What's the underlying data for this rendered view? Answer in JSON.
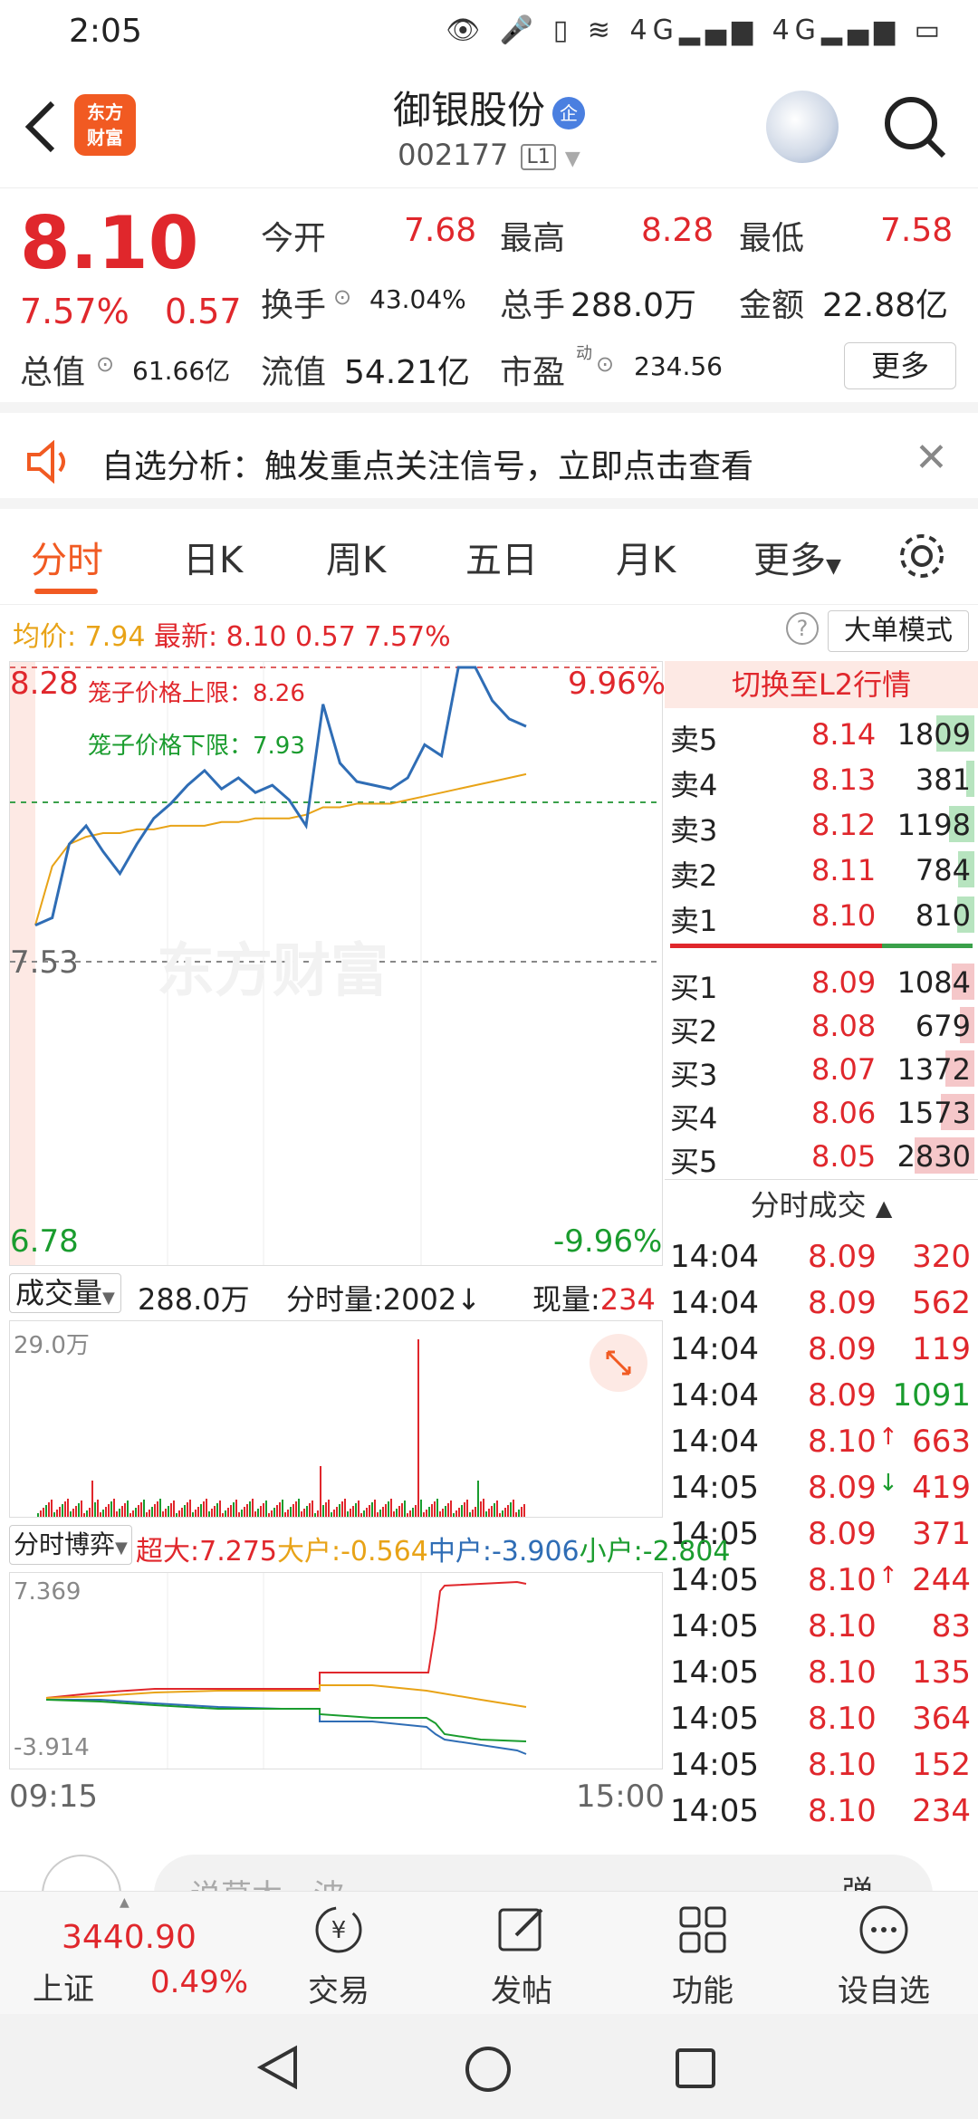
{
  "status_bar": {
    "time": "2:05",
    "icons": "👁 🎤 ▯ ≋ 4G▂▄▆ 4G▂▄▆ ▭"
  },
  "header": {
    "logo_text_1": "东方",
    "logo_text_2": "财富",
    "stock_name": "御银股份",
    "qi_badge": "企",
    "stock_code": "002177",
    "level": "L1"
  },
  "quote": {
    "price": "8.10",
    "change_pct": "7.57%",
    "change": "0.57",
    "open_label": "今开",
    "open": "7.68",
    "high_label": "最高",
    "high": "8.28",
    "low_label": "最低",
    "low": "7.58",
    "turnover_label": "换手",
    "turnover": "43.04%",
    "volume_label": "总手",
    "volume": "288.0万",
    "amount_label": "金额",
    "amount": "22.88亿",
    "mktcap_label": "总值",
    "mktcap": "61.66亿",
    "float_label": "流值",
    "float": "54.21亿",
    "pe_label": "市盈",
    "pe_sup": "动",
    "pe": "234.56",
    "more_button": "更多"
  },
  "alert": {
    "text": "自选分析：触发重点关注信号，立即点击查看"
  },
  "tabs": [
    "分时",
    "日K",
    "周K",
    "五日",
    "月K",
    "更多"
  ],
  "info_row": {
    "avg_label": "均价:",
    "avg": "7.94",
    "latest_label": "最新:",
    "latest": "8.10",
    "change": "0.57",
    "change_pct": "7.57%",
    "big_order_button": "大单模式"
  },
  "chart": {
    "top_price": "8.28",
    "top_pct": "9.96%",
    "bottom_price": "6.78",
    "bottom_pct": "-9.96%",
    "prev_close": "7.53",
    "upper_limit_label": "笼子价格上限：8.26",
    "lower_limit_label": "笼子价格下限：7.93",
    "watermark": "东方财富"
  },
  "chart_data": {
    "type": "line",
    "series": [
      {
        "values": [
          7.58,
          7.6,
          7.8,
          7.85,
          7.78,
          7.72,
          7.8,
          7.87,
          7.91,
          7.96,
          8.0,
          7.95,
          7.98,
          7.94,
          7.96,
          7.92,
          7.85,
          8.18,
          8.02,
          7.97,
          7.96,
          7.95,
          7.98,
          8.07,
          8.04,
          8.28,
          8.28,
          8.19,
          8.14,
          8.12
        ]
      },
      {
        "values": [
          7.58,
          7.74,
          7.8,
          7.82,
          7.83,
          7.83,
          7.84,
          7.84,
          7.85,
          7.85,
          7.85,
          7.86,
          7.86,
          7.87,
          7.87,
          7.87,
          7.88,
          7.9,
          7.9,
          7.91,
          7.91,
          7.91,
          7.92,
          7.93,
          7.94,
          7.95,
          7.96,
          7.97,
          7.98,
          7.99
        ]
      }
    ],
    "ylim": [
      6.78,
      8.28
    ]
  },
  "orderbook": {
    "switch_button": "切换至L2行情",
    "sell": [
      {
        "name": "卖5",
        "price": "8.14",
        "vol": "1809",
        "bar": 0.64
      },
      {
        "name": "卖4",
        "price": "8.13",
        "vol": "381",
        "bar": 0.13
      },
      {
        "name": "卖3",
        "price": "8.12",
        "vol": "1198",
        "bar": 0.42
      },
      {
        "name": "卖2",
        "price": "8.11",
        "vol": "784",
        "bar": 0.28
      },
      {
        "name": "卖1",
        "price": "8.10",
        "vol": "810",
        "bar": 0.29
      }
    ],
    "buy": [
      {
        "name": "买1",
        "price": "8.09",
        "vol": "1084",
        "bar": 0.38
      },
      {
        "name": "买2",
        "price": "8.08",
        "vol": "679",
        "bar": 0.24
      },
      {
        "name": "买3",
        "price": "8.07",
        "vol": "1372",
        "bar": 0.48
      },
      {
        "name": "买4",
        "price": "8.06",
        "vol": "1573",
        "bar": 0.56
      },
      {
        "name": "买5",
        "price": "8.05",
        "vol": "2830",
        "bar": 1.0
      }
    ],
    "ticks_title": "分时成交",
    "ticks": [
      {
        "time": "14:04",
        "price": "8.09",
        "arrow": "",
        "vol": "320",
        "color": "#e0272c"
      },
      {
        "time": "14:04",
        "price": "8.09",
        "arrow": "",
        "vol": "562",
        "color": "#e0272c"
      },
      {
        "time": "14:04",
        "price": "8.09",
        "arrow": "",
        "vol": "119",
        "color": "#e0272c"
      },
      {
        "time": "14:04",
        "price": "8.09",
        "arrow": "",
        "vol": "1091",
        "color": "#1a9c2e"
      },
      {
        "time": "14:04",
        "price": "8.10",
        "arrow": "↑",
        "vol": "663",
        "color": "#e0272c"
      },
      {
        "time": "14:05",
        "price": "8.09",
        "arrow": "↓",
        "vol": "419",
        "color": "#e0272c"
      },
      {
        "time": "14:05",
        "price": "8.09",
        "arrow": "",
        "vol": "371",
        "color": "#e0272c"
      },
      {
        "time": "14:05",
        "price": "8.10",
        "arrow": "↑",
        "vol": "244",
        "color": "#e0272c"
      },
      {
        "time": "14:05",
        "price": "8.10",
        "arrow": "",
        "vol": "83",
        "color": "#e0272c"
      },
      {
        "time": "14:05",
        "price": "8.10",
        "arrow": "",
        "vol": "135",
        "color": "#e0272c"
      },
      {
        "time": "14:05",
        "price": "8.10",
        "arrow": "",
        "vol": "364",
        "color": "#e0272c"
      },
      {
        "time": "14:05",
        "price": "8.10",
        "arrow": "",
        "vol": "152",
        "color": "#e0272c"
      },
      {
        "time": "14:05",
        "price": "8.10",
        "arrow": "",
        "vol": "234",
        "color": "#e0272c"
      }
    ]
  },
  "volume": {
    "selector": "成交量",
    "total": "288.0万",
    "minute_label": "分时量:2002",
    "minute_arrow": "↓",
    "now_label": "现量:",
    "now": "234",
    "max": "29.0万"
  },
  "game": {
    "selector": "分时博弈",
    "super_label": "超大:",
    "super": "7.275",
    "big_label": "大户:",
    "big": "-0.564",
    "mid_label": "中户:",
    "mid": "-3.906",
    "small_label": "小户:",
    "small": "-2.804",
    "top": "7.369",
    "bottom": "-3.914"
  },
  "time_axis": {
    "start": "09:15",
    "end": "15:00"
  },
  "comment": {
    "placeholder": "说草木一波",
    "right": "弹"
  },
  "bottom_nav": {
    "index_value": "3440.90",
    "index_name": "上证",
    "index_pct": "0.49%",
    "items": [
      "交易",
      "发帖",
      "功能",
      "设自选"
    ]
  },
  "colors": {
    "up": "#e0272c",
    "down": "#1a9c2e",
    "accent": "#f15a22",
    "price_line": "#2f6db5",
    "avg_line": "#e8a317"
  }
}
